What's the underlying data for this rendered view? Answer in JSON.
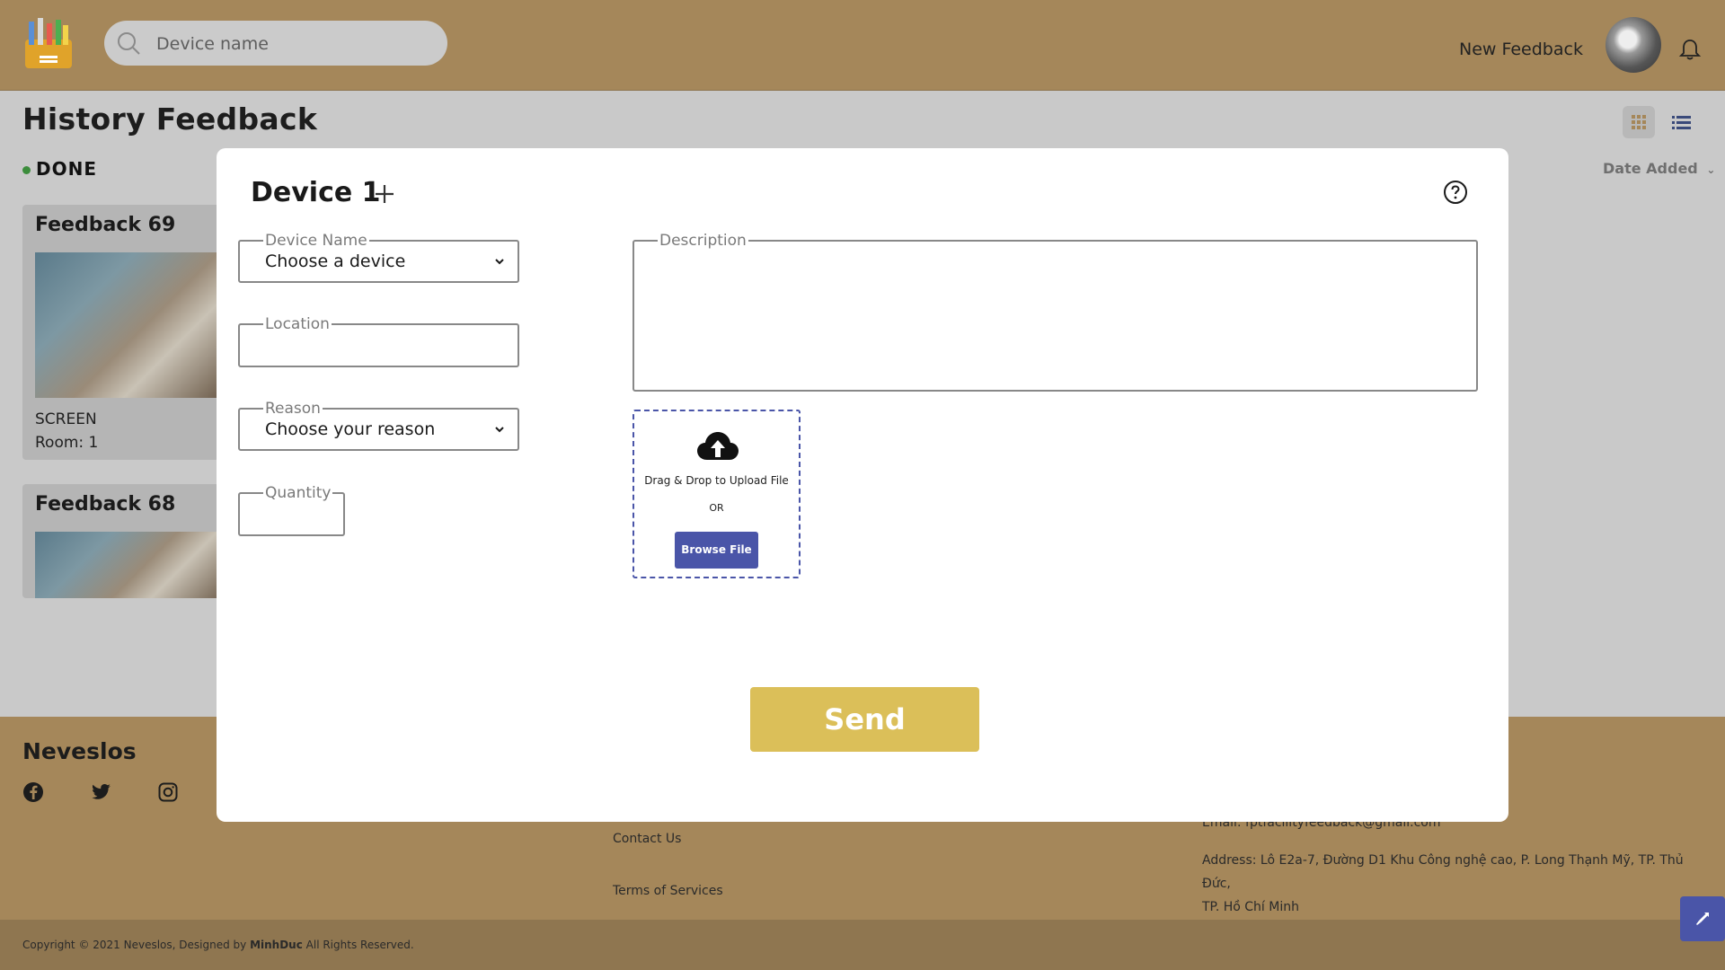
{
  "header": {
    "search_placeholder": "Device name",
    "new_feedback": "New Feedback"
  },
  "page": {
    "title": "History Feedback",
    "status": "DONE",
    "sort_label": "Date Added"
  },
  "cards": [
    {
      "title": "Feedback 69",
      "device": "SCREEN",
      "room": "Room: 1"
    },
    {
      "title": "Feedback 68"
    }
  ],
  "footer": {
    "brand": "Neveslos",
    "links": [
      "Contact Us",
      "Terms of Services"
    ],
    "email": "Email: fptfacilityfeedback@gmail.com",
    "address_line1": "Address: Lô E2a-7, Đường D1 Khu Công nghệ cao, P. Long Thạnh Mỹ, TP. Thủ Đức,",
    "address_line2": "TP. Hồ Chí Minh",
    "copyright_prefix": "Copyright © 2021 Neveslos, Designed by",
    "copyright_author": "MinhDuc",
    "copyright_suffix": "All Rights Reserved."
  },
  "modal": {
    "title": "Device 1",
    "device_name_label": "Device Name",
    "device_name_value": "Choose a device",
    "location_label": "Location",
    "location_value": "",
    "reason_label": "Reason",
    "reason_value": "Choose your reason",
    "quantity_label": "Quantity",
    "quantity_value": "",
    "description_label": "Description",
    "description_value": "",
    "upload_text": "Drag & Drop to Upload File",
    "upload_or": "OR",
    "browse_label": "Browse File",
    "send_label": "Send"
  },
  "colors": {
    "header_bg": "#a5875a",
    "accent_blue": "#4a55a8",
    "send_yellow": "#dbbf59",
    "status_green": "#3c8d3c"
  }
}
